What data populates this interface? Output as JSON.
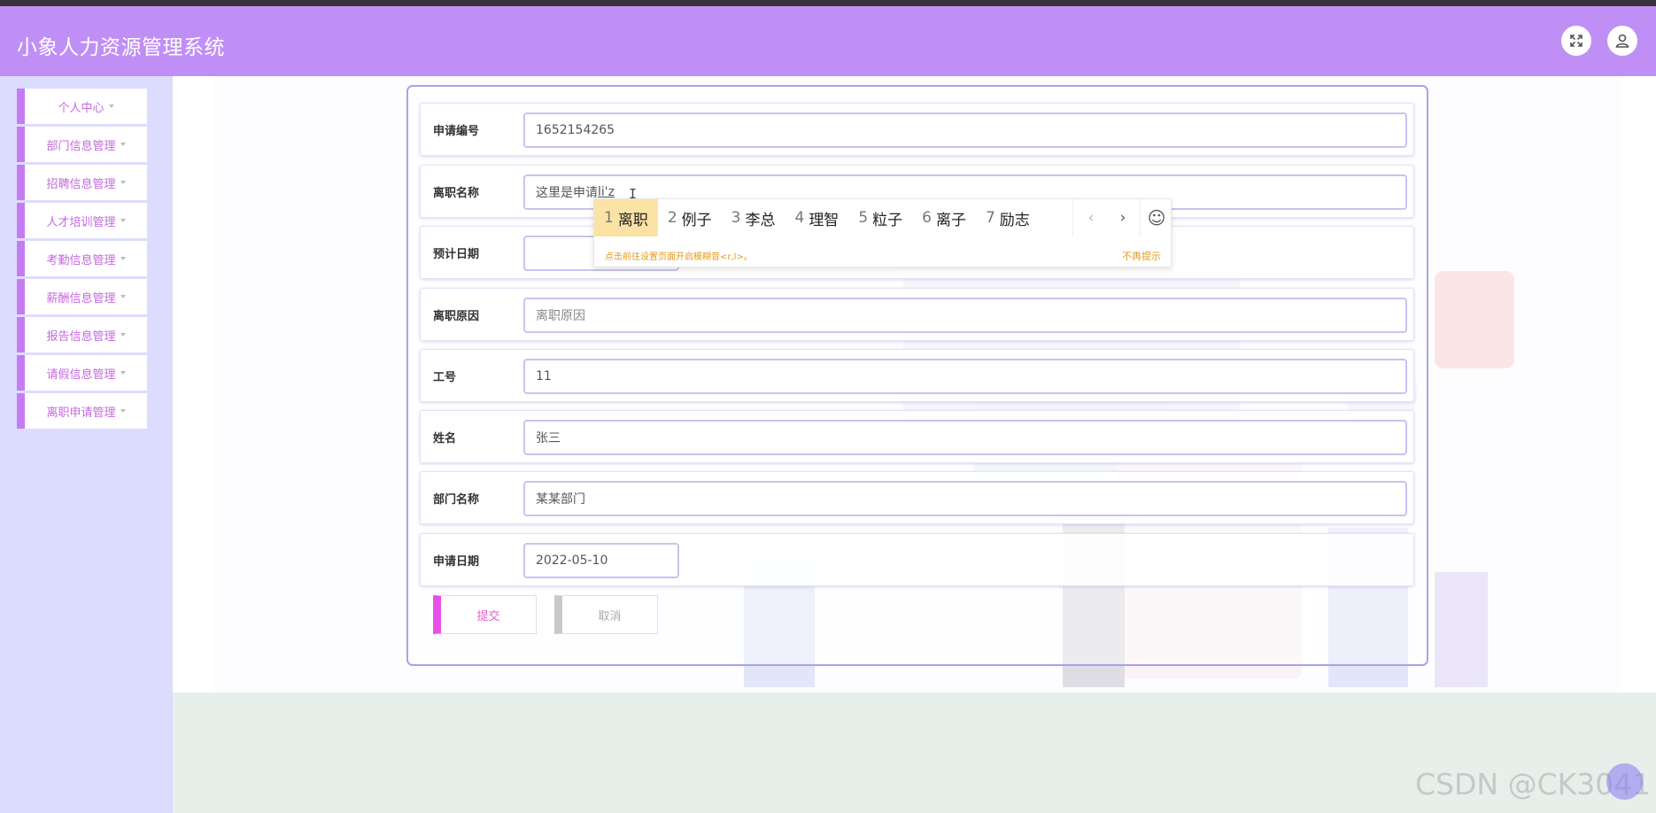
{
  "app": {
    "title": "小象人力资源管理系统",
    "header_icons": [
      "fullscreen-icon",
      "user-icon"
    ]
  },
  "sidebar": {
    "items": [
      {
        "label": "个人中心"
      },
      {
        "label": "部门信息管理"
      },
      {
        "label": "招聘信息管理"
      },
      {
        "label": "人才培训管理"
      },
      {
        "label": "考勤信息管理"
      },
      {
        "label": "薪酬信息管理"
      },
      {
        "label": "报告信息管理"
      },
      {
        "label": "请假信息管理"
      },
      {
        "label": "离职申请管理"
      }
    ]
  },
  "form": {
    "fields": [
      {
        "label": "申请编号",
        "value": "1652154265",
        "placeholder": ""
      },
      {
        "label": "离职名称",
        "value": "这里是申请",
        "composing": "li'z",
        "placeholder": ""
      },
      {
        "label": "预计日期",
        "value": "",
        "placeholder": ""
      },
      {
        "label": "离职原因",
        "value": "",
        "placeholder": "离职原因"
      },
      {
        "label": "工号",
        "value": "11",
        "placeholder": ""
      },
      {
        "label": "姓名",
        "value": "张三",
        "placeholder": ""
      },
      {
        "label": "部门名称",
        "value": "某某部门",
        "placeholder": ""
      },
      {
        "label": "申请日期",
        "value": "2022-05-10",
        "placeholder": ""
      }
    ],
    "submit_label": "提交",
    "cancel_label": "取消"
  },
  "ime": {
    "candidates": [
      {
        "num": "1",
        "text": "离职"
      },
      {
        "num": "2",
        "text": "例子"
      },
      {
        "num": "3",
        "text": "李总"
      },
      {
        "num": "4",
        "text": "理智"
      },
      {
        "num": "5",
        "text": "粒子"
      },
      {
        "num": "6",
        "text": "离子"
      },
      {
        "num": "7",
        "text": "励志"
      }
    ],
    "prev_glyph": "‹",
    "next_glyph": "›",
    "emoji_glyph": "☺",
    "hint": "点击前往设置页面开启模糊音<r,l>。",
    "dismiss": "不再提示"
  },
  "watermark": "CSDN @CK3041",
  "colors": {
    "header": "#c08ff5",
    "sidebar_bg": "#dcdcff",
    "accent": "#c57cf2",
    "submit_accent": "#e84fe8",
    "ime_highlight": "#fbe3a5"
  }
}
